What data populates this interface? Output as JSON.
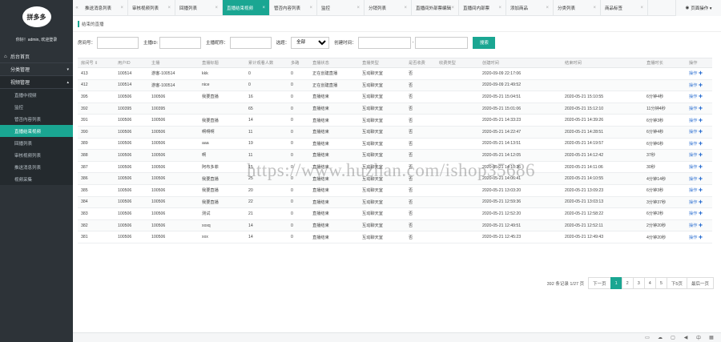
{
  "sidebar": {
    "logo": "拼多多",
    "welcome": "你好！admin, 欢迎登录",
    "groups": [
      {
        "label": "后台首页",
        "icon": "⌂",
        "arrow": ""
      },
      {
        "label": "分类管理",
        "icon": "",
        "arrow": "▾"
      },
      {
        "label": "视频管理",
        "icon": "",
        "arrow": "▴"
      }
    ],
    "items": [
      {
        "label": "直播中视频"
      },
      {
        "label": "监控"
      },
      {
        "label": "管否内容列表"
      },
      {
        "label": "直播结束视频"
      },
      {
        "label": "回播列表"
      },
      {
        "label": "审核视频列表"
      },
      {
        "label": "推送消息列表"
      },
      {
        "label": "视频采集"
      }
    ]
  },
  "tabs": [
    {
      "label": "推送消息列表"
    },
    {
      "label": "审核视频列表"
    },
    {
      "label": "回播列表"
    },
    {
      "label": "直播结束视频"
    },
    {
      "label": "管否内容列表"
    },
    {
      "label": "监控"
    },
    {
      "label": "分销列表"
    },
    {
      "label": "直播间外部票编辑"
    },
    {
      "label": "直播间内部票"
    },
    {
      "label": "添加商品"
    },
    {
      "label": "分类列表"
    },
    {
      "label": "商品标签"
    }
  ],
  "page_op": "页面操作 ▾",
  "crumb": "结束的直播",
  "filters": {
    "room_label": "房间号：",
    "host_id_label": "主播ID:",
    "host_name_label": "主播昵称：",
    "pick_label": "选题：",
    "pick_value": "全部",
    "created_label": "创建时间：",
    "search_label": "搜索",
    "date_sep": "-"
  },
  "table": {
    "headers": [
      "房间号 ⇕",
      "用户ID",
      "主播",
      "直播标题",
      "累计观看人数",
      "多路",
      "直播状态",
      "直播类型",
      "是否收费",
      "收费类型",
      "创建时间",
      "结束时间",
      "直播时长",
      "操作"
    ],
    "op_label": "操作 ✚",
    "rows": [
      [
        "413",
        "100514",
        "游客-100514",
        "kkk",
        "0",
        "0",
        "正在创建直播",
        "互动聊天室",
        "否",
        "",
        "2020-09-09 22:17:06",
        "",
        ""
      ],
      [
        "412",
        "100514",
        "游客-100514",
        "nice",
        "0",
        "0",
        "正在创建直播",
        "互动聊天室",
        "否",
        "",
        "2020-09-09 21:49:52",
        "",
        ""
      ],
      [
        "395",
        "100506",
        "100506",
        "我要直播",
        "16",
        "0",
        "直播结束",
        "互动聊天室",
        "否",
        "",
        "2020-05-21 15:04:51",
        "2020-05-21 15:10:55",
        "6分钟4秒"
      ],
      [
        "392",
        "100395",
        "100395",
        "",
        "65",
        "0",
        "直播结束",
        "互动聊天室",
        "否",
        "",
        "2020-05-21 15:01:06",
        "2020-05-21 15:12:10",
        "11分钟4秒"
      ],
      [
        "391",
        "100506",
        "100506",
        "我要直播",
        "14",
        "0",
        "直播结束",
        "互动聊天室",
        "否",
        "",
        "2020-05-21 14:33:23",
        "2020-05-21 14:39:26",
        "6分钟3秒"
      ],
      [
        "390",
        "100506",
        "100506",
        "啊啊啊",
        "11",
        "0",
        "直播结束",
        "互动聊天室",
        "否",
        "",
        "2020-05-21 14:22:47",
        "2020-05-21 14:28:51",
        "6分钟4秒"
      ],
      [
        "389",
        "100506",
        "100506",
        "aaa",
        "19",
        "0",
        "直播结束",
        "互动聊天室",
        "否",
        "",
        "2020-05-21 14:13:51",
        "2020-05-21 14:19:57",
        "6分钟6秒"
      ],
      [
        "388",
        "100506",
        "100506",
        "啊",
        "11",
        "0",
        "直播结束",
        "互动聊天室",
        "否",
        "",
        "2020-05-21 14:12:05",
        "2020-05-21 14:12:42",
        "37秒"
      ],
      [
        "387",
        "100506",
        "100506",
        "阿布多菲",
        "15",
        "0",
        "直播结束",
        "互动聊天室",
        "否",
        "",
        "2020-05-21 14:10:36",
        "2020-05-21 14:11:06",
        "30秒"
      ],
      [
        "386",
        "100506",
        "100506",
        "我要直播",
        "25",
        "0",
        "直播结束",
        "互动聊天室",
        "否",
        "",
        "2020-05-21 14:06:41",
        "2020-05-21 14:10:55",
        "4分钟14秒"
      ],
      [
        "385",
        "100506",
        "100506",
        "我要直播",
        "20",
        "0",
        "直播结束",
        "互动聊天室",
        "否",
        "",
        "2020-05-21 13:03:20",
        "2020-05-21 13:09:23",
        "6分钟3秒"
      ],
      [
        "384",
        "100506",
        "100506",
        "我要直播",
        "22",
        "0",
        "直播结束",
        "互动聊天室",
        "否",
        "",
        "2020-05-21 12:59:36",
        "2020-05-21 13:03:13",
        "3分钟37秒"
      ],
      [
        "383",
        "100506",
        "100506",
        "测试",
        "21",
        "0",
        "直播结束",
        "互动聊天室",
        "否",
        "",
        "2020-05-21 12:52:20",
        "2020-05-21 12:58:22",
        "6分钟2秒"
      ],
      [
        "382",
        "100506",
        "100506",
        "xxxq",
        "14",
        "0",
        "直播结束",
        "互动聊天室",
        "否",
        "",
        "2020-05-21 12:49:51",
        "2020-05-21 12:52:11",
        "2分钟20秒"
      ],
      [
        "381",
        "100506",
        "100506",
        "xxx",
        "14",
        "0",
        "直播结束",
        "互动聊天室",
        "否",
        "",
        "2020-05-21 12:45:23",
        "2020-05-21 12:49:43",
        "4分钟20秒"
      ]
    ]
  },
  "pager": {
    "info": "392 条记录 1/27 页",
    "prev": "下一页",
    "pages": [
      "1",
      "2",
      "3",
      "4",
      "5"
    ],
    "next5": "下5页",
    "last": "最后一页"
  },
  "watermark": "https://www.huzhan.com/ishop35686"
}
